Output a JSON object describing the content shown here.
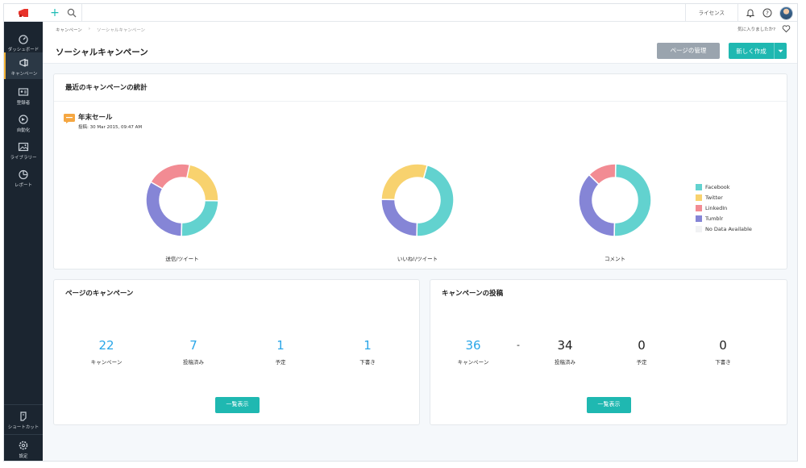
{
  "colors": {
    "accent": "#1fb8b1",
    "facebook": "#62d2cf",
    "twitter": "#f8d26e",
    "linkedin": "#f28b93",
    "tumblr": "#8585d6",
    "no_data": "#f1f2f4",
    "sidebar_bg": "#1b2530",
    "number_blue": "#2aa6e8"
  },
  "sidebar": {
    "logo_icon": "megaphone-logo-icon",
    "items": [
      {
        "label": "ダッシュボード",
        "icon": "gauge-icon"
      },
      {
        "label": "キャンペーン",
        "icon": "megaphone-icon"
      },
      {
        "label": "登録者",
        "icon": "id-card-icon"
      },
      {
        "label": "自動化",
        "icon": "automation-icon"
      },
      {
        "label": "ライブラリー",
        "icon": "image-icon"
      },
      {
        "label": "レポート",
        "icon": "pie-chart-icon"
      }
    ],
    "bottom_items": [
      {
        "label": "ショートカット",
        "icon": "shortcut-icon"
      },
      {
        "label": "設定",
        "icon": "gear-icon"
      }
    ]
  },
  "topbar": {
    "license_label": "ライセンス"
  },
  "breadcrumb": {
    "parent": "キャンペーン",
    "separator": "›",
    "current": "ソーシャルキャンペーン"
  },
  "favorite_prompt": "気に入りましたか?",
  "page_title": "ソーシャルキャンペーン",
  "buttons": {
    "manage_pages": "ページの管理",
    "create_new": "新しく作成"
  },
  "stats_card": {
    "title": "最近のキャンペーンの統計",
    "campaign_name": "年末セール",
    "posted_label": "投稿: 30 Mar 2015, 09:47 AM"
  },
  "chart_data": [
    {
      "type": "pie",
      "variant": "donut",
      "label": "送信/ツイート",
      "slices": [
        {
          "name": "Facebook",
          "value": 25
        },
        {
          "name": "Twitter",
          "value": 22
        },
        {
          "name": "LinkedIn",
          "value": 20
        },
        {
          "name": "Tumblr",
          "value": 33
        }
      ]
    },
    {
      "type": "pie",
      "variant": "donut",
      "label": "いいね!/ツイート",
      "slices": [
        {
          "name": "Facebook",
          "value": 46
        },
        {
          "name": "Twitter",
          "value": 29
        },
        {
          "name": "LinkedIn",
          "value": 0
        },
        {
          "name": "Tumblr",
          "value": 25
        }
      ]
    },
    {
      "type": "pie",
      "variant": "donut",
      "label": "コメント",
      "slices": [
        {
          "name": "Facebook",
          "value": 50
        },
        {
          "name": "Twitter",
          "value": 0
        },
        {
          "name": "LinkedIn",
          "value": 13
        },
        {
          "name": "Tumblr",
          "value": 37
        }
      ]
    }
  ],
  "legend": [
    {
      "name": "Facebook",
      "color": "#62d2cf"
    },
    {
      "name": "Twitter",
      "color": "#f8d26e"
    },
    {
      "name": "LinkedIn",
      "color": "#f28b93"
    },
    {
      "name": "Tumblr",
      "color": "#8585d6"
    },
    {
      "name": "No Data Available",
      "color": "#f1f2f4"
    }
  ],
  "page_campaigns": {
    "title": "ページのキャンペーン",
    "stats": [
      {
        "value": "22",
        "label": "キャンペーン"
      },
      {
        "value": "7",
        "label": "投稿済み"
      },
      {
        "value": "1",
        "label": "予定"
      },
      {
        "value": "1",
        "label": "下書き"
      }
    ],
    "button": "一覧表示"
  },
  "campaign_posts": {
    "title": "キャンペーンの投稿",
    "stats": [
      {
        "value": "36",
        "label": "キャンペーン"
      },
      {
        "value": "34",
        "label": "投稿済み"
      },
      {
        "value": "0",
        "label": "予定"
      },
      {
        "value": "0",
        "label": "下書き"
      }
    ],
    "separator": "-",
    "button": "一覧表示"
  }
}
